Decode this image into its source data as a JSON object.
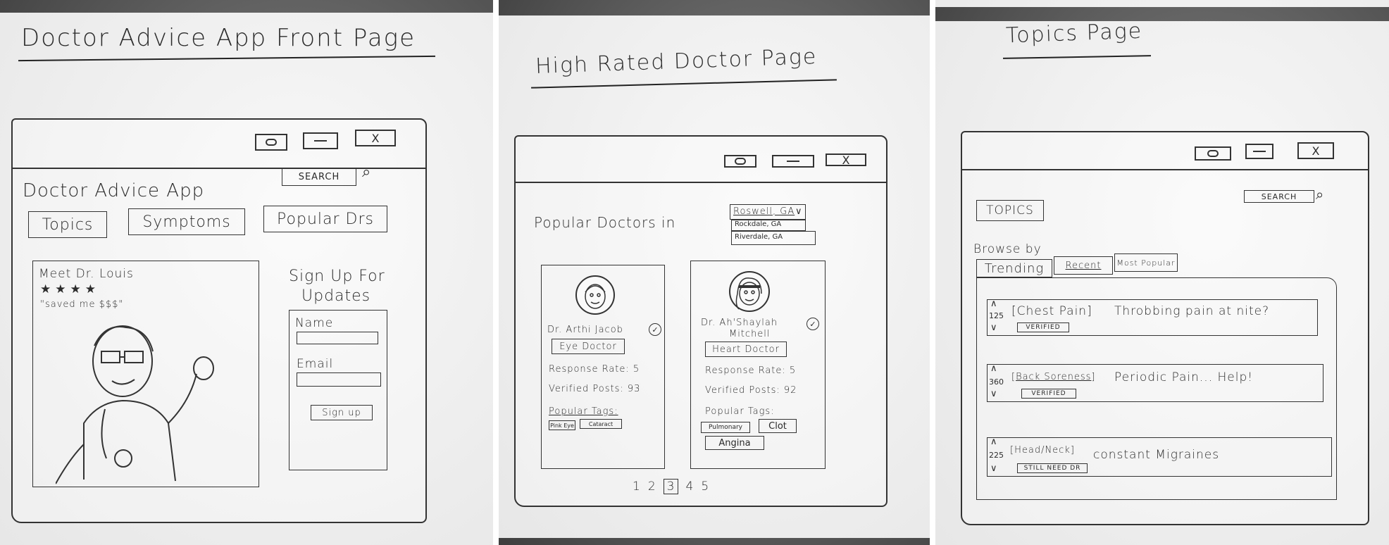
{
  "panel1": {
    "page_title": "Doctor Advice App Front Page",
    "window_controls": {
      "restore": "O",
      "minimize": "–",
      "close": "X"
    },
    "app_name": "Doctor Advice App",
    "search": {
      "label": "SEARCH"
    },
    "nav": [
      "Topics",
      "Symptoms",
      "Popular Drs"
    ],
    "featured": {
      "heading": "Meet Dr. Louis",
      "stars": "★★★★",
      "quote": "\"saved me $$$\""
    },
    "signup": {
      "heading_line1": "Sign Up For",
      "heading_line2": "Updates",
      "name_label": "Name",
      "email_label": "Email",
      "button": "Sign up"
    }
  },
  "panel2": {
    "page_title": "High Rated Doctor Page",
    "window_controls": {
      "restore": "O",
      "minimize": "–",
      "close": "X"
    },
    "popular_label": "Popular Doctors in",
    "location_dropdown": {
      "selected": "Roswell, GA",
      "options": [
        "Rockdale, GA",
        "Riverdale, GA"
      ]
    },
    "doctors": [
      {
        "name": "Dr. Arthi Jacob",
        "specialty": "Eye Doctor",
        "response_rate": "Response Rate: 5",
        "verified_posts": "Verified Posts: 93",
        "tags_label": "Popular Tags:",
        "tags": [
          "Pink Eye",
          "Cataract"
        ]
      },
      {
        "name_line1": "Dr. Ah'Shaylah",
        "name_line2": "Mitchell",
        "specialty": "Heart Doctor",
        "response_rate": "Response Rate: 5",
        "verified_posts": "Verified Posts: 92",
        "tags_label": "Popular Tags:",
        "tags": [
          "Pulmonary",
          "Clot",
          "Angina"
        ]
      }
    ],
    "pagination": [
      "1",
      "2",
      "3",
      "4",
      "5"
    ],
    "current_page": "3"
  },
  "panel3": {
    "page_title": "Topics Page",
    "window_controls": {
      "restore": "O",
      "minimize": "–",
      "close": "X"
    },
    "search": {
      "label": "SEARCH"
    },
    "topics_button": "TOPICS",
    "browse_label": "Browse by",
    "tabs": [
      "Trending",
      "Recent",
      "Most Popular"
    ],
    "posts": [
      {
        "votes": "125",
        "tag": "Chest Pain",
        "title": "Throbbing pain at nite?",
        "status": "VERIFIED"
      },
      {
        "votes": "360",
        "tag": "Back Soreness",
        "title": "Periodic Pain... Help!",
        "status": "VERIFIED"
      },
      {
        "votes": "225",
        "tag": "Head/Neck",
        "title": "constant Migraines",
        "status": "STILL NEED DR"
      }
    ]
  }
}
